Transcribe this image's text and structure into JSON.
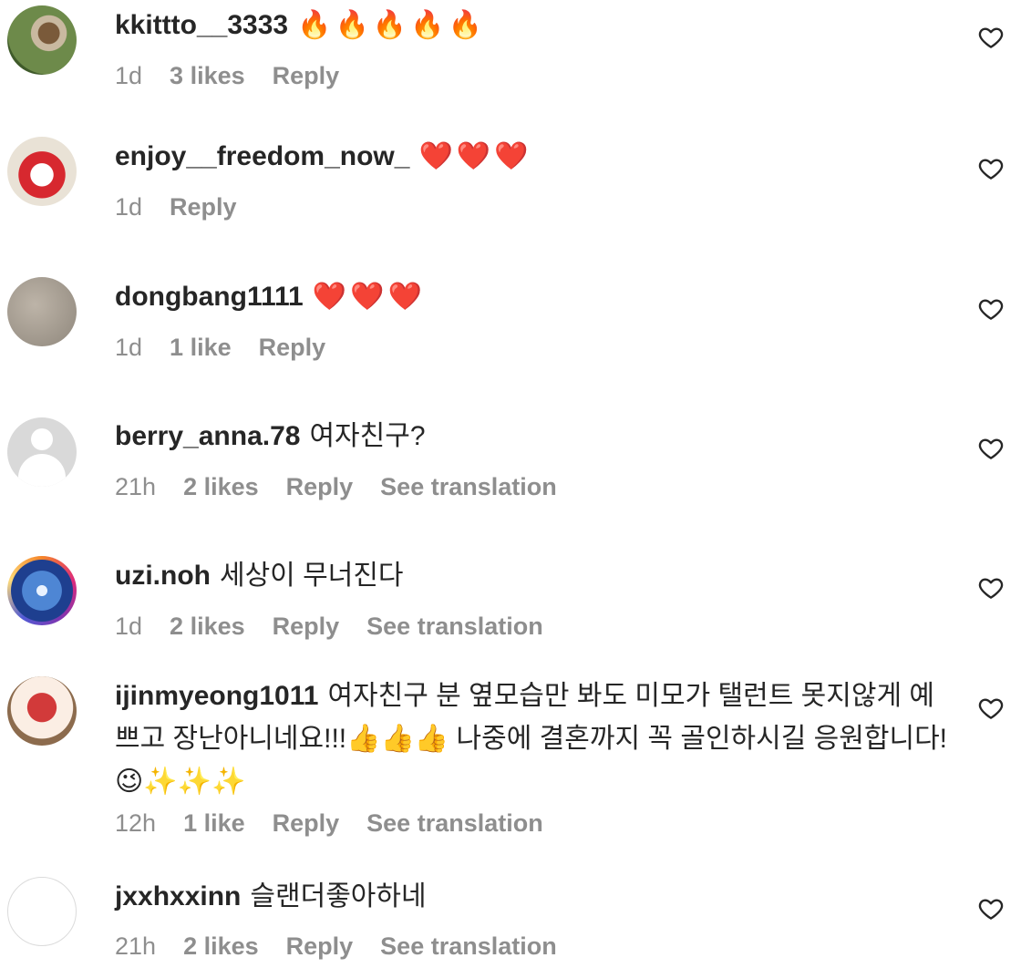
{
  "comments": [
    {
      "username": "kkittto__3333",
      "text": "",
      "emoji": "🔥🔥🔥🔥🔥",
      "time": "1d",
      "likes": "3 likes",
      "reply": "Reply",
      "translate": ""
    },
    {
      "username": "enjoy__freedom_now_",
      "text": "",
      "emoji": "❤️❤️❤️",
      "time": "1d",
      "likes": "",
      "reply": "Reply",
      "translate": ""
    },
    {
      "username": "dongbang1111",
      "text": "",
      "emoji": "❤️❤️❤️",
      "time": "1d",
      "likes": "1 like",
      "reply": "Reply",
      "translate": ""
    },
    {
      "username": "berry_anna.78",
      "text": "여자친구?",
      "emoji": "",
      "time": "21h",
      "likes": "2 likes",
      "reply": "Reply",
      "translate": "See translation"
    },
    {
      "username": "uzi.noh",
      "text": "세상이 무너진다",
      "emoji": "",
      "time": "1d",
      "likes": "2 likes",
      "reply": "Reply",
      "translate": "See translation"
    },
    {
      "username": "ijinmyeong1011",
      "text": "여자친구 분 옆모습만 봐도 미모가 탤런트 못지않게 예쁘고 장난아니네요!!!👍👍👍 나중에 결혼까지 꼭 골인하시길 응원합니다!😉✨✨✨",
      "emoji": "",
      "time": "12h",
      "likes": "1 like",
      "reply": "Reply",
      "translate": "See translation"
    },
    {
      "username": "jxxhxxinn",
      "text": "슬랜더좋아하네",
      "emoji": "",
      "time": "21h",
      "likes": "2 likes",
      "reply": "Reply",
      "translate": "See translation"
    }
  ],
  "icons": {
    "like": "heart-outline-icon"
  },
  "colors": {
    "text": "#262626",
    "meta": "#8e8e8e"
  }
}
